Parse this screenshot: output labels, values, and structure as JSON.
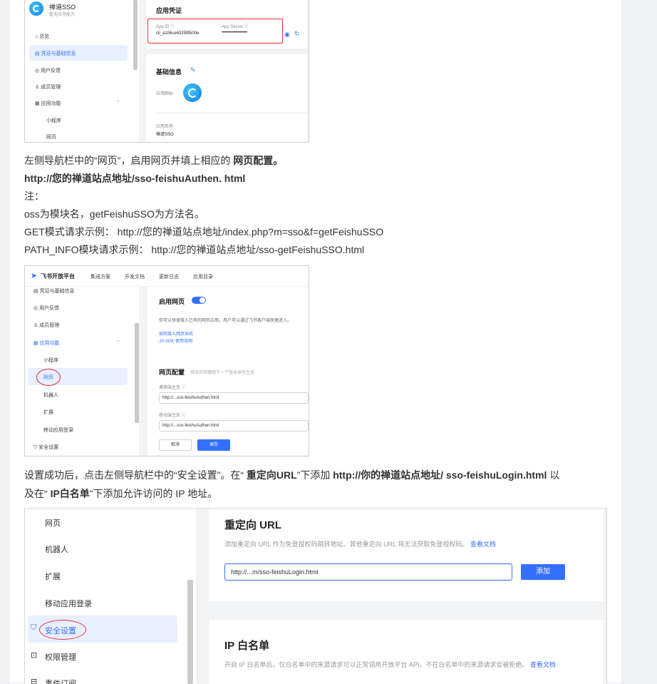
{
  "shot1": {
    "app_name": "禅道SSO",
    "app_sub": "暂无应用能力",
    "nav": [
      "总览",
      "凭证与基础信息",
      "用户反馈",
      "成员管理",
      "应用功能",
      "小程序",
      "网页"
    ],
    "cred_title": "应用凭证",
    "app_id_label": "App ID ⓘ",
    "app_id_value": "cli_a106ce6325f8500e",
    "secret_label": "App Secret ⓘ",
    "secret_value": "••••••••••••••••••••••••••••••••",
    "basic_title": "基础信息",
    "icon_label": "应用图标",
    "name_label": "应用名称",
    "name_value": "禅道SSO"
  },
  "text": {
    "p1_a": "左侧导航栏中的“网页”，启用网页并填上相应的 ",
    "p1_b": "网页配置。",
    "p2": "http://您的禅道站点地址/sso-feishuAuthen. html",
    "p3": "注：",
    "p4": "oss为模块名，getFeishuSSO为方法名。",
    "p5": "GET模式请求示例： http://您的禅道站点地址/index.php?m=sso&f=getFeishuSSO",
    "p6": "PATH_INFO模块请求示例： http://您的禅道站点地址/sso-getFeishuSSO.html",
    "p7_a": "设置成功后，点击左侧导航栏中的“安全设置”。在“ ",
    "p7_b": "重定向URL",
    "p7_c": "”下添加 ",
    "p7_d": "http://你的禅道站点地址/ sso-feishuLogin.html",
    "p7_e": " 以",
    "p8_a": "及在“ ",
    "p8_b": "IP白名单",
    "p8_c": "”下添加允许访问的 IP 地址。"
  },
  "shot2": {
    "brand": "飞书开放平台",
    "topnav": [
      "集成方案",
      "开发文档",
      "更新日志",
      "应用目录"
    ],
    "nav": [
      "凭证与基础信息",
      "用户反馈",
      "成员管理",
      "应用功能",
      "小程序",
      "网页",
      "机器人",
      "扩展",
      "移动应用登录",
      "安全设置"
    ],
    "enable_label": "启用网页",
    "desc": "你可以快速接入已有的网页应用。用户可以通过飞书客户端快速进入。",
    "link1": "如何接入网页系统",
    "link2": "JS-SDK 使用说明",
    "config_title": "网页配置",
    "config_hint": "修改后将跟随下一个版本发布生效",
    "desktop_label": "桌面端主页 ⓘ",
    "desktop_value": "http://...sso-feishuAuthen.html",
    "mobile_label": "移动端主页 ⓘ",
    "mobile_value": "http://...sso-feishuAuthen.html",
    "cancel": "取消",
    "save": "保存"
  },
  "shot3": {
    "nav": [
      "网页",
      "机器人",
      "扩展",
      "移动应用登录",
      "安全设置",
      "权限管理",
      "事件订阅"
    ],
    "redirect_title": "重定向 URL",
    "redirect_desc": "添加重定向 URL 作为免登授权码跳转地址。其他重定向 URL 将无法获取免登授权码。",
    "doc_link": "查看文档",
    "redirect_value": "http://...m/sso-feishuLogin.html",
    "add_button": "添加",
    "ip_title": "IP 白名单",
    "ip_desc": "开启 IP 白名单后，仅白名单中的来源请求可以正常调用开放平台 API，不在白名单中的来源请求会被拒绝。",
    "ip_doc_link": "查看文档"
  },
  "colors": {
    "accent": "#3370ff",
    "highlight": "#e0303c",
    "nav_active_bg": "#e8efff"
  }
}
